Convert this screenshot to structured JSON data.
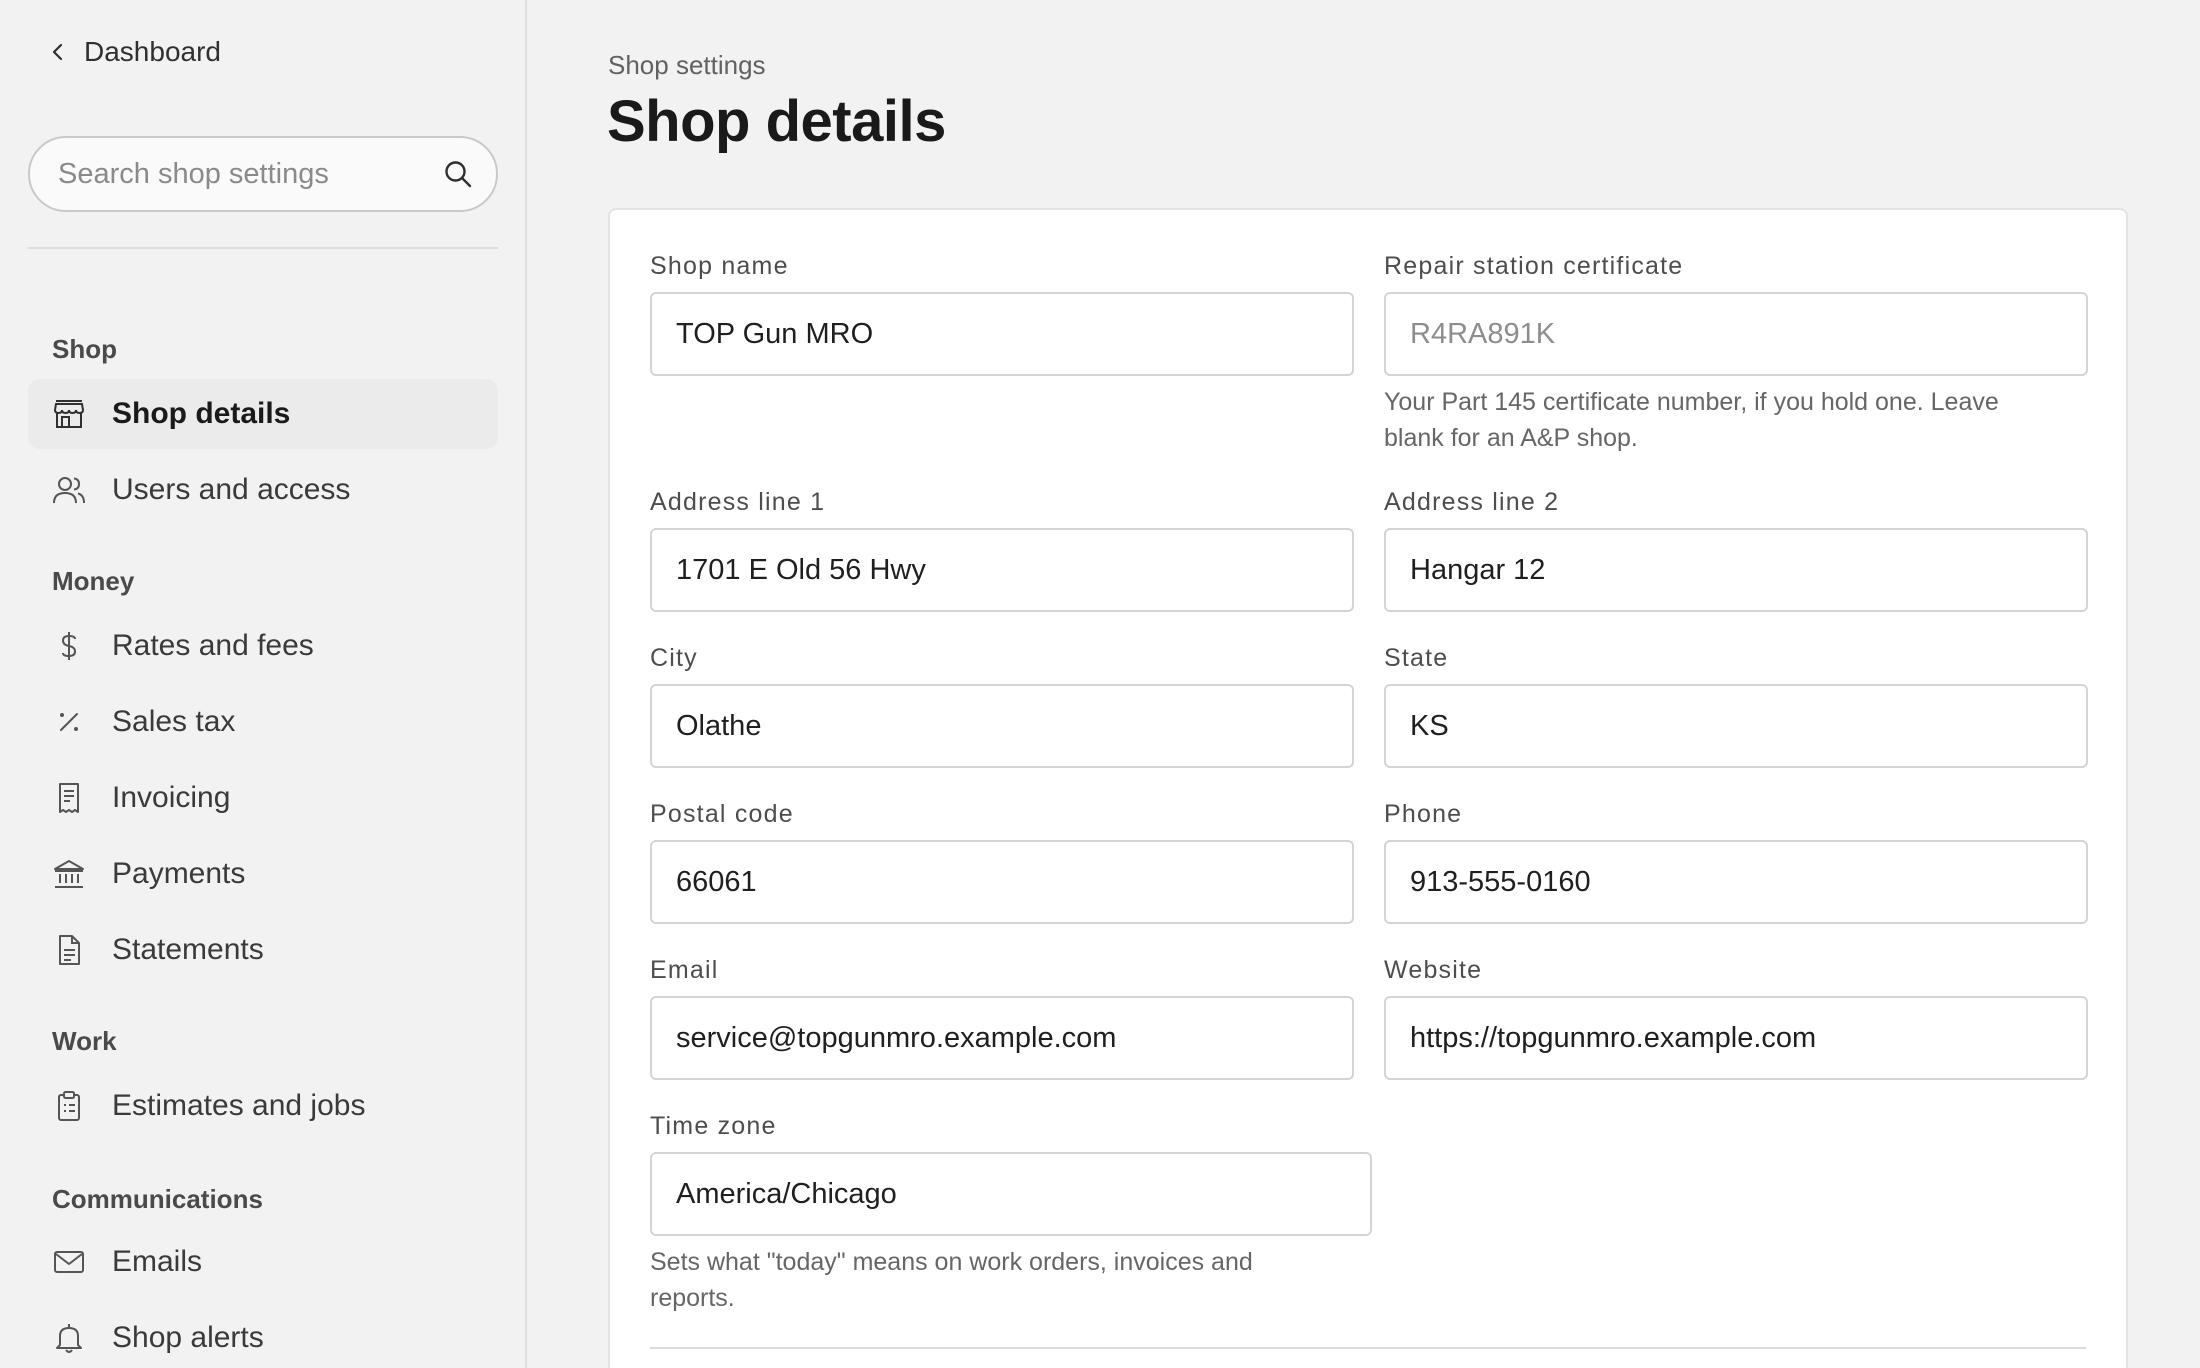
{
  "sidebar": {
    "back_label": "Dashboard",
    "search_placeholder": "Search shop settings",
    "sections": [
      {
        "title": "Shop",
        "items": [
          {
            "label": "Shop details",
            "icon": "storefront-icon",
            "active": true
          },
          {
            "label": "Users and access",
            "icon": "users-icon",
            "active": false
          }
        ]
      },
      {
        "title": "Money",
        "items": [
          {
            "label": "Rates and fees",
            "icon": "dollar-icon",
            "active": false
          },
          {
            "label": "Sales tax",
            "icon": "percent-icon",
            "active": false
          },
          {
            "label": "Invoicing",
            "icon": "receipt-icon",
            "active": false
          },
          {
            "label": "Payments",
            "icon": "bank-icon",
            "active": false
          },
          {
            "label": "Statements",
            "icon": "document-icon",
            "active": false
          }
        ]
      },
      {
        "title": "Work",
        "items": [
          {
            "label": "Estimates and jobs",
            "icon": "clipboard-icon",
            "active": false
          }
        ]
      },
      {
        "title": "Communications",
        "items": [
          {
            "label": "Emails",
            "icon": "mail-icon",
            "active": false
          },
          {
            "label": "Shop alerts",
            "icon": "bell-icon",
            "active": false
          }
        ]
      }
    ]
  },
  "header": {
    "breadcrumb": "Shop settings",
    "title": "Shop details"
  },
  "form": {
    "shop_name": {
      "label": "Shop name",
      "value": "TOP Gun MRO"
    },
    "repair_cert": {
      "label": "Repair station certificate",
      "placeholder": "R4RA891K",
      "help_line1": "Your Part 145 certificate number, if you hold one. Leave",
      "help_line2": "blank for an A&P shop."
    },
    "address1": {
      "label": "Address line 1",
      "value": "1701 E Old 56 Hwy"
    },
    "address2": {
      "label": "Address line 2",
      "value": "Hangar 12"
    },
    "city": {
      "label": "City",
      "value": "Olathe"
    },
    "state": {
      "label": "State",
      "value": "KS"
    },
    "postal": {
      "label": "Postal code",
      "value": "66061"
    },
    "phone": {
      "label": "Phone",
      "value": "913-555-0160"
    },
    "email": {
      "label": "Email",
      "value": "service@topgunmro.example.com"
    },
    "website": {
      "label": "Website",
      "value": "https://topgunmro.example.com"
    },
    "timezone": {
      "label": "Time zone",
      "value": "America/Chicago",
      "help_line1": "Sets what \"today\" means on work orders, invoices and",
      "help_line2": "reports."
    }
  }
}
